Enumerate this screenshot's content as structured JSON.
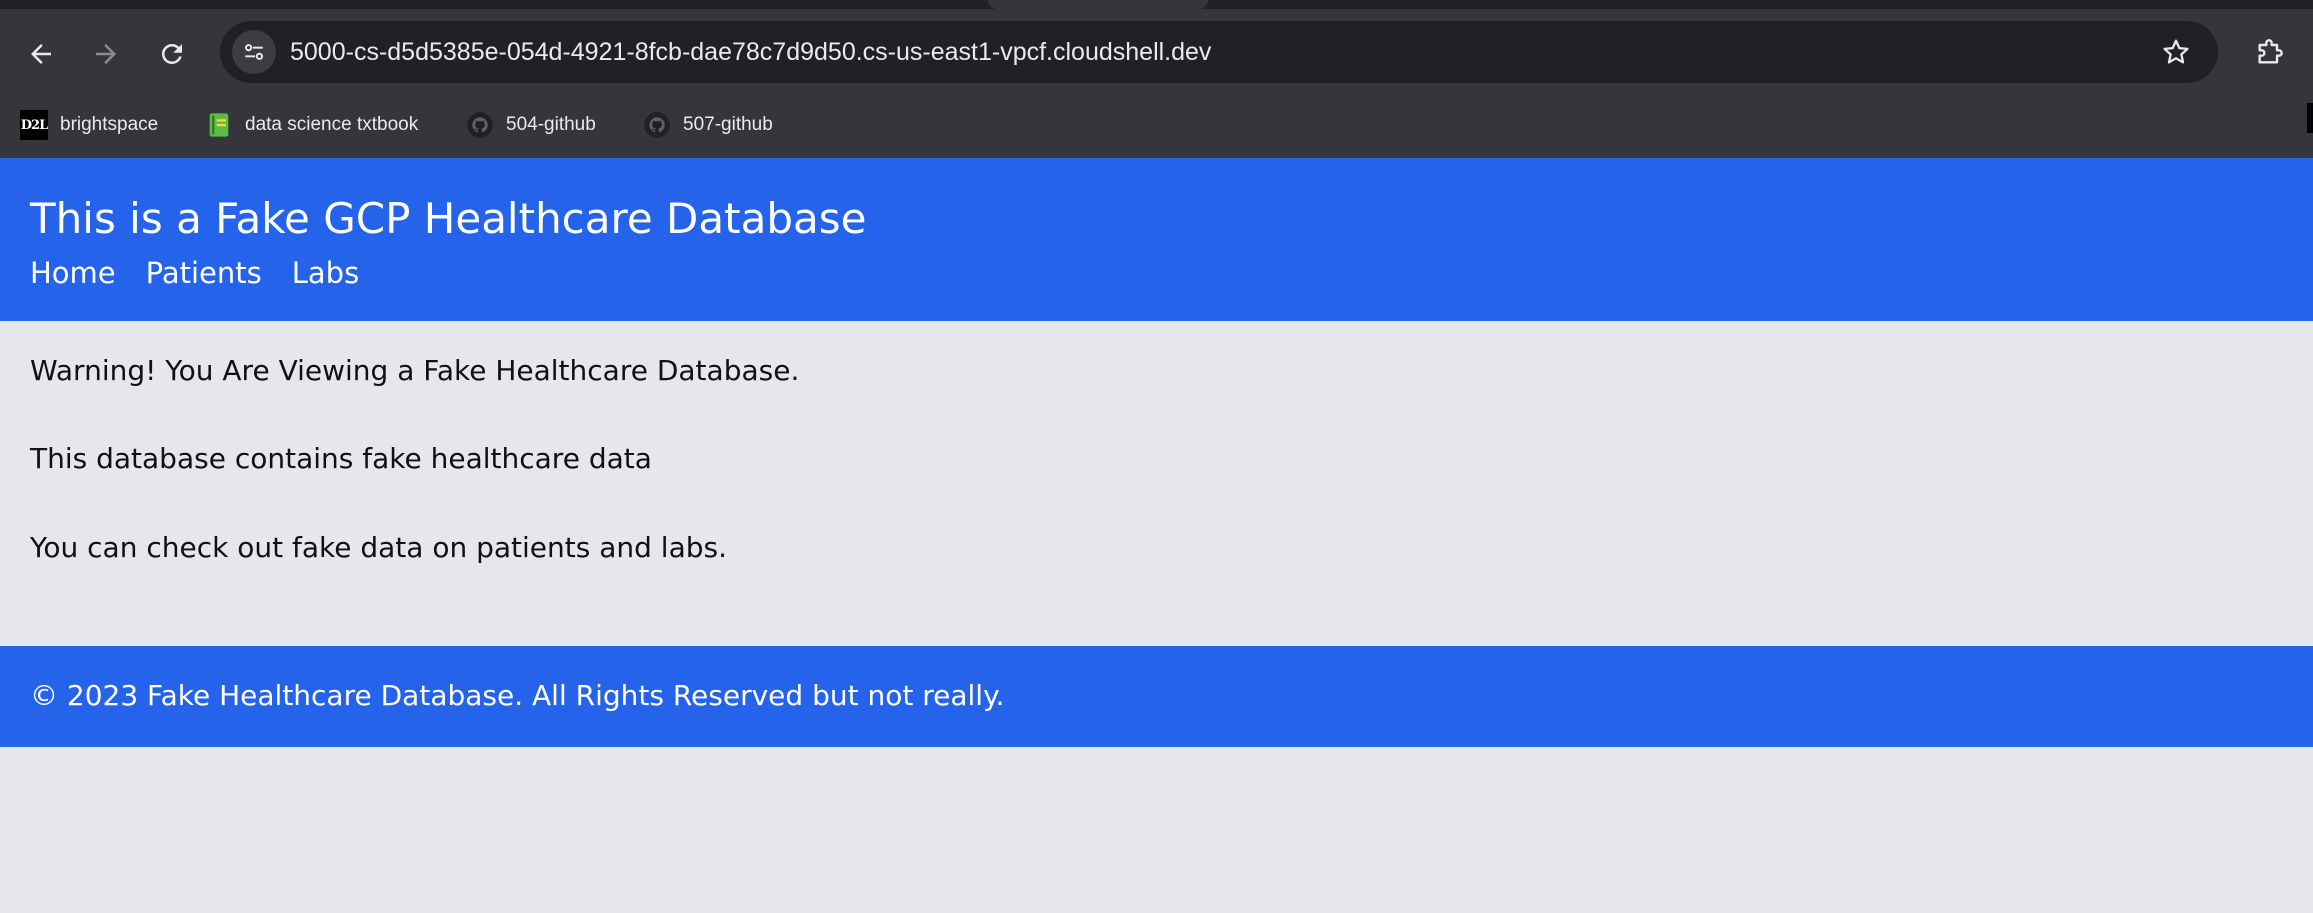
{
  "browser": {
    "url": "5000-cs-d5d5385e-054d-4921-8fcb-dae78c7d9d50.cs-us-east1-vpcf.cloudshell.dev",
    "icons": {
      "back": "arrow-left-icon",
      "forward": "arrow-right-icon",
      "reload": "reload-icon",
      "site_info": "tune-icon",
      "bookmark_star": "star-icon",
      "extensions": "puzzle-icon"
    },
    "bookmarks": [
      {
        "label": "brightspace",
        "icon": "d2l-icon",
        "badge": "D2L"
      },
      {
        "label": "data science txtbook",
        "icon": "book-icon"
      },
      {
        "label": "504-github",
        "icon": "github-icon"
      },
      {
        "label": "507-github",
        "icon": "github-icon"
      }
    ]
  },
  "site": {
    "title": "This is a Fake GCP Healthcare Database",
    "nav": [
      "Home",
      "Patients",
      "Labs"
    ],
    "paragraphs": [
      "Warning! You Are Viewing a Fake Healthcare Database.",
      "This database contains fake healthcare data",
      "You can check out fake data on patients and labs."
    ],
    "footer": "© 2023 Fake Healthcare Database. All Rights Reserved but not really."
  },
  "colors": {
    "brand_blue": "#2563eb",
    "page_bg": "#e5e7eb",
    "chrome_bg": "#35363a"
  }
}
